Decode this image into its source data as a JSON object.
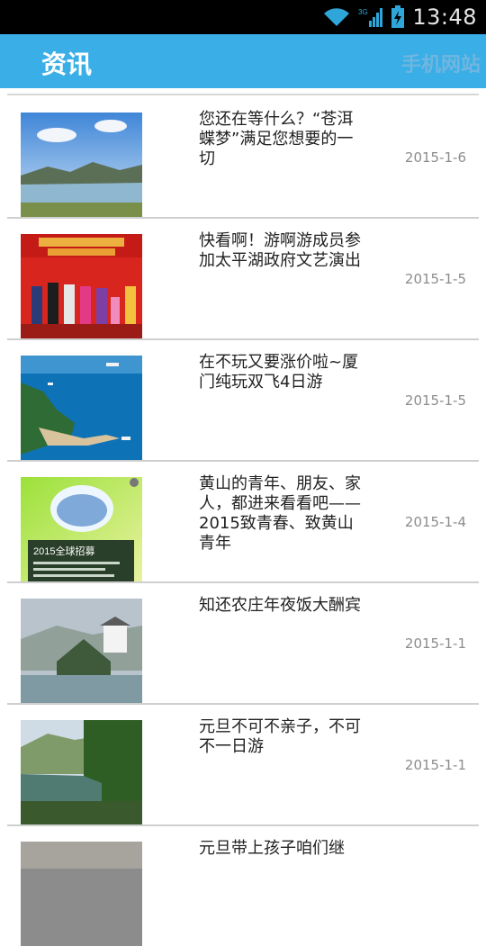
{
  "status": {
    "network": "3G",
    "time": "13:48"
  },
  "header": {
    "title": "资讯",
    "site_link": "手机网站"
  },
  "news": [
    {
      "title": "您还在等什么？“苍洱蝶梦”满足您想要的一切",
      "date": "2015-1-6"
    },
    {
      "title": "快看啊！游啊游成员参加太平湖政府文艺演出",
      "date": "2015-1-5"
    },
    {
      "title": "在不玩又要涨价啦~厦门纯玩双飞4日游",
      "date": "2015-1-5"
    },
    {
      "title": "黄山的青年、朋友、家人，都进来看看吧——2015致青春、致黄山青年",
      "date": "2015-1-4"
    },
    {
      "title": "知还农庄年夜饭大酬宾",
      "date": "2015-1-1"
    },
    {
      "title": "元旦不可不亲子，不可不一日游",
      "date": "2015-1-1"
    },
    {
      "title": "元旦带上孩子咱们继",
      "date": ""
    }
  ],
  "thumb4_caption": "2015全球招募"
}
